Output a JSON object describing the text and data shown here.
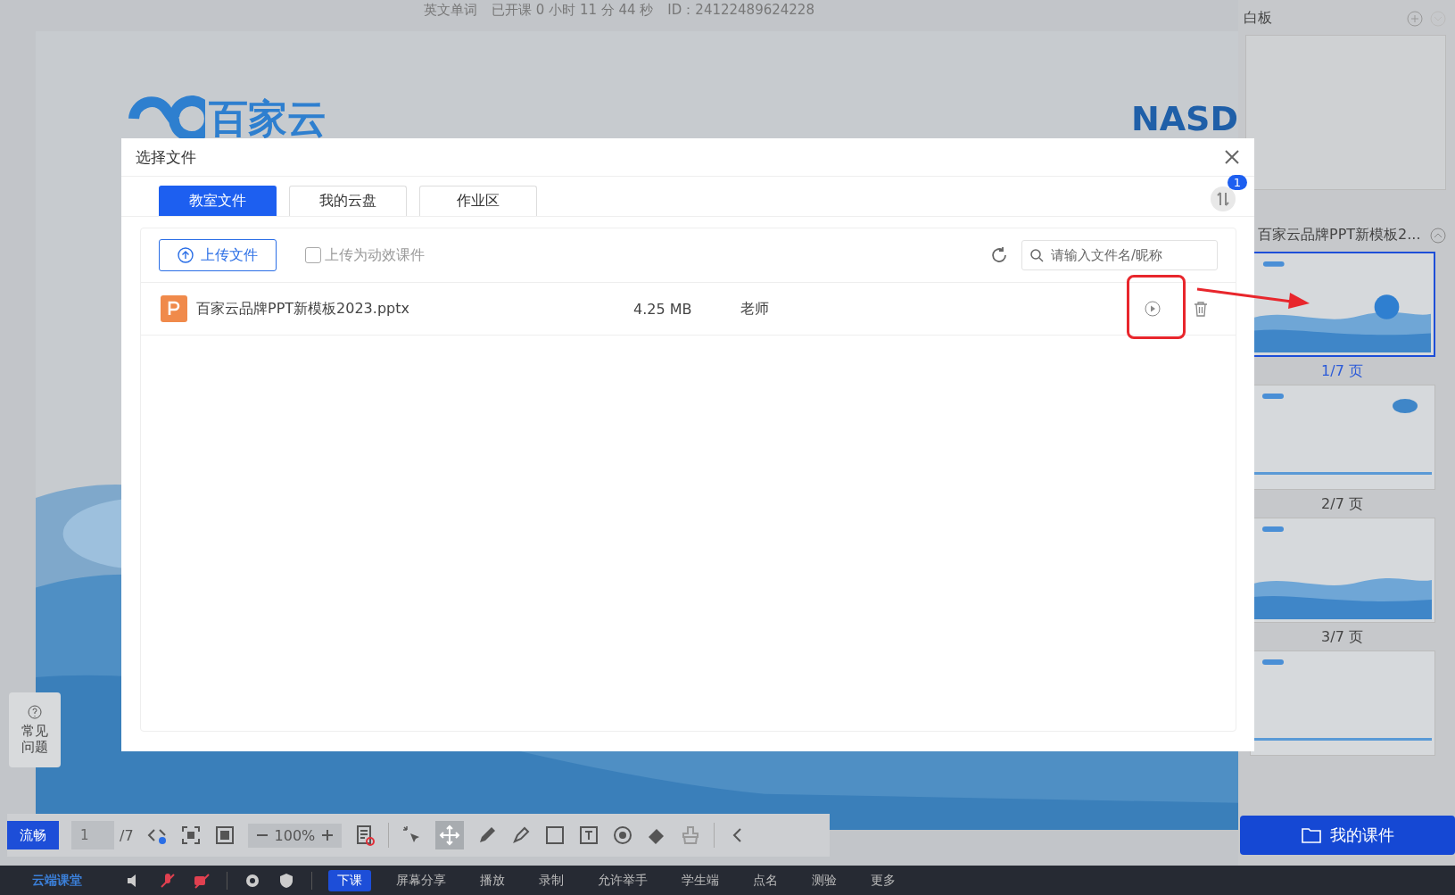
{
  "header": {
    "title": "英文单词",
    "elapsed": "已开课 0 小时 11 分 44 秒",
    "id": "ID：24122489624228"
  },
  "slide": {
    "logo": "百家云",
    "brand": "NASD"
  },
  "help": {
    "label": "常见问题"
  },
  "toolbar": {
    "quality": "流畅",
    "page": "1",
    "total": "/7",
    "zoom": "100%"
  },
  "bottom_bar": {
    "brand": "云端课堂",
    "items": [
      {
        "label": "下课",
        "kind": "primary"
      },
      {
        "label": "屏幕分享",
        "kind": "plain"
      },
      {
        "label": "播放",
        "kind": "plain"
      },
      {
        "label": "录制",
        "kind": "plain"
      },
      {
        "label": "允许举手",
        "kind": "plain"
      },
      {
        "label": "学生端",
        "kind": "plain"
      },
      {
        "label": "点名",
        "kind": "plain"
      },
      {
        "label": "测验",
        "kind": "plain"
      },
      {
        "label": "更多",
        "kind": "plain"
      }
    ]
  },
  "whiteboard": {
    "title": "白板"
  },
  "courseware": {
    "title": "百家云品牌PPT新模板2...",
    "pages": [
      {
        "label": "1/7 页",
        "selected": true
      },
      {
        "label": "2/7 页",
        "selected": false
      },
      {
        "label": "3/7 页",
        "selected": false
      },
      {
        "selected": false
      }
    ]
  },
  "my_courseware": "我的课件",
  "dialog": {
    "title": "选择文件",
    "tabs": [
      {
        "label": "教室文件",
        "selected": true
      },
      {
        "label": "我的云盘",
        "selected": false
      },
      {
        "label": "作业区",
        "selected": false
      }
    ],
    "badge": "1",
    "upload": "上传文件",
    "animated": {
      "label": "上传为动效课件",
      "checked": false
    },
    "search": {
      "placeholder": "请输入文件名/昵称"
    },
    "files": [
      {
        "name": "百家云品牌PPT新模板2023.pptx",
        "size": "4.25 MB",
        "owner": "老师"
      }
    ]
  }
}
